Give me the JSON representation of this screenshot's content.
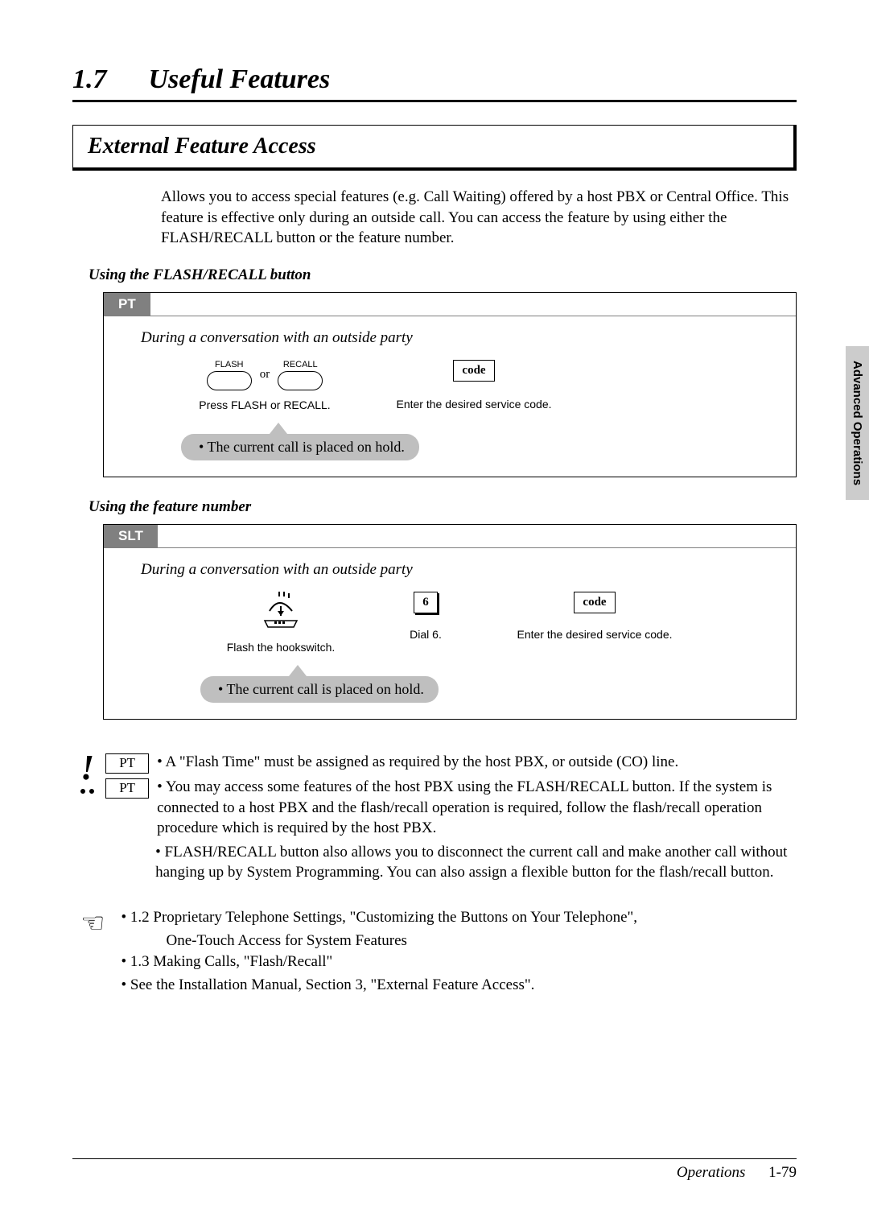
{
  "header": {
    "number": "1.7",
    "title": "Useful Features"
  },
  "feature_title": "External Feature Access",
  "intro": "Allows you to access special features (e.g. Call Waiting) offered by a host PBX or Central Office. This feature is effective only during an outside call. You can access the feature by using either the FLASH/RECALL button or the feature number.",
  "proc1": {
    "heading": "Using the FLASH/RECALL button",
    "tab": "PT",
    "condition": "During a conversation with an outside party",
    "btn1": "FLASH",
    "btn2": "RECALL",
    "or": "or",
    "code_label": "code",
    "caption1": "Press FLASH or RECALL.",
    "caption2": "Enter the desired service code.",
    "callout": "The current call is placed on hold."
  },
  "proc2": {
    "heading": "Using the feature number",
    "tab": "SLT",
    "condition": "During a conversation with an outside party",
    "dial_digit": "6",
    "code_label": "code",
    "caption1": "Flash the hookswitch.",
    "caption2": "Dial 6.",
    "caption3": "Enter the desired service code.",
    "callout": "The current call is placed on hold."
  },
  "notes": {
    "badge": "PT",
    "n1": "A \"Flash Time\" must be assigned as required by the host PBX, or outside (CO) line.",
    "n2": "You may access some features of the host PBX using the FLASH/RECALL button. If the system is connected to a host PBX and the flash/recall operation is required, follow the flash/recall operation procedure which is required by the host PBX.",
    "n3": "FLASH/RECALL button also allows you to disconnect the current call and make another call without hanging up by System Programming. You can also assign a flexible button for the flash/recall button."
  },
  "refs": {
    "r1": "1.2 Proprietary Telephone Settings, \"Customizing the Buttons on Your Telephone\",",
    "r1b": "One-Touch Access for System Features",
    "r2": "1.3 Making Calls, \"Flash/Recall\"",
    "r3": "See the Installation Manual, Section 3, \"External Feature Access\"."
  },
  "side_tab": "Advanced Operations",
  "footer": {
    "label": "Operations",
    "page": "1-79"
  }
}
